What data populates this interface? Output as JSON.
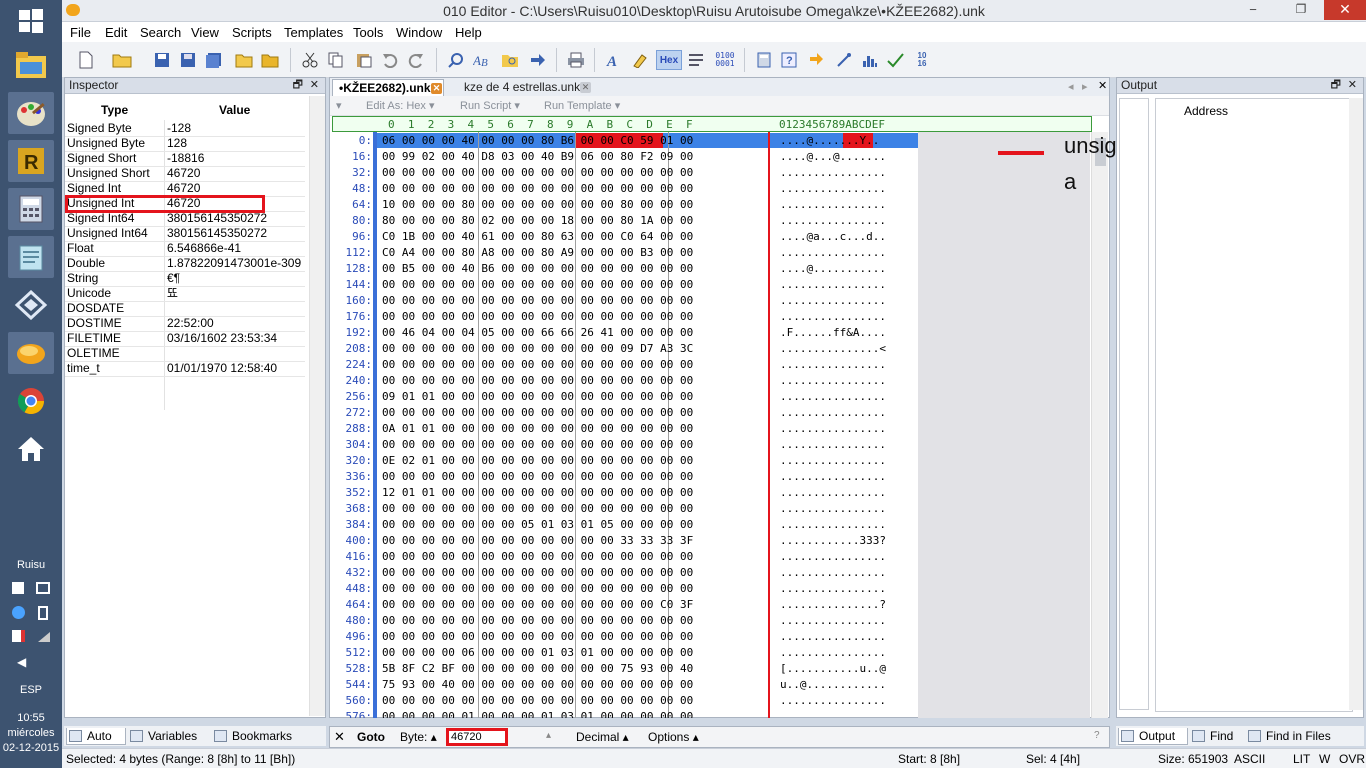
{
  "window": {
    "title": "010 Editor - C:\\Users\\Ruisu010\\Desktop\\Ruisu Arutoisube Omega\\kze\\•KŽEE2682).unk"
  },
  "menu": [
    "File",
    "Edit",
    "Search",
    "View",
    "Scripts",
    "Templates",
    "Tools",
    "Window",
    "Help"
  ],
  "taskbar": {
    "user": "Ruisu",
    "lang": "ESP",
    "time": "10:55",
    "day": "miércoles",
    "date": "02-12-2015"
  },
  "inspector": {
    "title": "Inspector",
    "col_type": "Type",
    "col_value": "Value",
    "rows": [
      {
        "type": "Signed Byte",
        "value": "-128"
      },
      {
        "type": "Unsigned Byte",
        "value": "128"
      },
      {
        "type": "Signed Short",
        "value": "-18816"
      },
      {
        "type": "Unsigned Short",
        "value": "46720"
      },
      {
        "type": "Signed Int",
        "value": "46720"
      },
      {
        "type": "Unsigned Int",
        "value": "46720"
      },
      {
        "type": "Signed Int64",
        "value": "380156145350272"
      },
      {
        "type": "Unsigned Int64",
        "value": "380156145350272"
      },
      {
        "type": "Float",
        "value": "6.546866e-41"
      },
      {
        "type": "Double",
        "value": "1.87822091473001e-309"
      },
      {
        "type": "String",
        "value": "€¶"
      },
      {
        "type": "Unicode",
        "value": "뚀"
      },
      {
        "type": "DOSDATE",
        "value": ""
      },
      {
        "type": "DOSTIME",
        "value": "22:52:00"
      },
      {
        "type": "FILETIME",
        "value": "03/16/1602 23:53:34"
      },
      {
        "type": "OLETIME",
        "value": ""
      },
      {
        "type": "time_t",
        "value": "01/01/1970 12:58:40"
      }
    ],
    "tabs": [
      "Auto",
      "Variables",
      "Bookmarks"
    ]
  },
  "editor": {
    "tabs": [
      "•KŽEE2682).unk",
      "kze de 4 estrellas.unk"
    ],
    "script_bar": [
      "Edit As: Hex",
      "Run Script",
      "Run Template"
    ],
    "hex_header": "0  1  2  3  4  5  6  7  8  9  A  B  C  D  E  F",
    "ascii_header": "0123456789ABCDEF",
    "rows": [
      {
        "off": "0:",
        "hex": "06 00 00 00 40 00 00 00 80 B6 00 00 C0 59 01 00",
        "asc": "....@.......Y.."
      },
      {
        "off": "16:",
        "hex": "00 99 02 00 40 D8 03 00 40 B9 06 00 80 F2 09 00",
        "asc": "....@...@......."
      },
      {
        "off": "32:",
        "hex": "00 00 00 00 00 00 00 00 00 00 00 00 00 00 00 00",
        "asc": "................"
      },
      {
        "off": "48:",
        "hex": "00 00 00 00 00 00 00 00 00 00 00 00 00 00 00 00",
        "asc": "................"
      },
      {
        "off": "64:",
        "hex": "10 00 00 00 80 00 00 00 00 00 00 00 80 00 00 00",
        "asc": "................"
      },
      {
        "off": "80:",
        "hex": "80 00 00 00 80 02 00 00 00 18 00 00 80 1A 00 00",
        "asc": "................"
      },
      {
        "off": "96:",
        "hex": "C0 1B 00 00 40 61 00 00 80 63 00 00 C0 64 00 00",
        "asc": "....@a...c...d.."
      },
      {
        "off": "112:",
        "hex": "C0 A4 00 00 80 A8 00 00 80 A9 00 00 00 B3 00 00",
        "asc": "................"
      },
      {
        "off": "128:",
        "hex": "00 B5 00 00 40 B6 00 00 00 00 00 00 00 00 00 00",
        "asc": "....@..........."
      },
      {
        "off": "144:",
        "hex": "00 00 00 00 00 00 00 00 00 00 00 00 00 00 00 00",
        "asc": "................"
      },
      {
        "off": "160:",
        "hex": "00 00 00 00 00 00 00 00 00 00 00 00 00 00 00 00",
        "asc": "................"
      },
      {
        "off": "176:",
        "hex": "00 00 00 00 00 00 00 00 00 00 00 00 00 00 00 00",
        "asc": "................"
      },
      {
        "off": "192:",
        "hex": "00 46 04 00 04 05 00 00 66 66 26 41 00 00 00 00",
        "asc": ".F......ff&A...."
      },
      {
        "off": "208:",
        "hex": "00 00 00 00 00 00 00 00 00 00 00 00 09 D7 A3 3C",
        "asc": "...............<"
      },
      {
        "off": "224:",
        "hex": "00 00 00 00 00 00 00 00 00 00 00 00 00 00 00 00",
        "asc": "................"
      },
      {
        "off": "240:",
        "hex": "00 00 00 00 00 00 00 00 00 00 00 00 00 00 00 00",
        "asc": "................"
      },
      {
        "off": "256:",
        "hex": "09 01 01 00 00 00 00 00 00 00 00 00 00 00 00 00",
        "asc": "................"
      },
      {
        "off": "272:",
        "hex": "00 00 00 00 00 00 00 00 00 00 00 00 00 00 00 00",
        "asc": "................"
      },
      {
        "off": "288:",
        "hex": "0A 01 01 00 00 00 00 00 00 00 00 00 00 00 00 00",
        "asc": "................"
      },
      {
        "off": "304:",
        "hex": "00 00 00 00 00 00 00 00 00 00 00 00 00 00 00 00",
        "asc": "................"
      },
      {
        "off": "320:",
        "hex": "0E 02 01 00 00 00 00 00 00 00 00 00 00 00 00 00",
        "asc": "................"
      },
      {
        "off": "336:",
        "hex": "00 00 00 00 00 00 00 00 00 00 00 00 00 00 00 00",
        "asc": "................"
      },
      {
        "off": "352:",
        "hex": "12 01 01 00 00 00 00 00 00 00 00 00 00 00 00 00",
        "asc": "................"
      },
      {
        "off": "368:",
        "hex": "00 00 00 00 00 00 00 00 00 00 00 00 00 00 00 00",
        "asc": "................"
      },
      {
        "off": "384:",
        "hex": "00 00 00 00 00 00 00 05 01 03 01 05 00 00 00 00",
        "asc": "................"
      },
      {
        "off": "400:",
        "hex": "00 00 00 00 00 00 00 00 00 00 00 00 33 33 33 3F",
        "asc": "............333?"
      },
      {
        "off": "416:",
        "hex": "00 00 00 00 00 00 00 00 00 00 00 00 00 00 00 00",
        "asc": "................"
      },
      {
        "off": "432:",
        "hex": "00 00 00 00 00 00 00 00 00 00 00 00 00 00 00 00",
        "asc": "................"
      },
      {
        "off": "448:",
        "hex": "00 00 00 00 00 00 00 00 00 00 00 00 00 00 00 00",
        "asc": "................"
      },
      {
        "off": "464:",
        "hex": "00 00 00 00 00 00 00 00 00 00 00 00 00 00 C0 3F",
        "asc": "...............?"
      },
      {
        "off": "480:",
        "hex": "00 00 00 00 00 00 00 00 00 00 00 00 00 00 00 00",
        "asc": "................"
      },
      {
        "off": "496:",
        "hex": "00 00 00 00 00 00 00 00 00 00 00 00 00 00 00 00",
        "asc": "................"
      },
      {
        "off": "512:",
        "hex": "00 00 00 00 06 00 00 00 01 03 01 00 00 00 00 00",
        "asc": "................"
      },
      {
        "off": "528:",
        "hex": "5B 8F C2 BF 00 00 00 00 00 00 00 00 75 93 00 40",
        "asc": "[...........u..@"
      },
      {
        "off": "544:",
        "hex": "75 93 00 40 00 00 00 00 00 00 00 00 00 00 00 00",
        "asc": "u..@............"
      },
      {
        "off": "560:",
        "hex": "00 00 00 00 00 00 00 00 00 00 00 00 00 00 00 00",
        "asc": "................"
      },
      {
        "off": "576:",
        "hex": "00 00 00 00 01 00 00 00 01 03 01 00 00 00 00 00",
        "asc": "................"
      }
    ]
  },
  "annotation": {
    "text": "unsigned int en funcion ir a"
  },
  "output": {
    "title": "Output",
    "col": "Address",
    "tabs": [
      "Output",
      "Find",
      "Find in Files"
    ]
  },
  "goto": {
    "label": "Goto",
    "byte_label": "Byte:",
    "value": "46720",
    "mode": "Decimal",
    "options": "Options"
  },
  "status": {
    "selected": "Selected: 4 bytes (Range: 8 [8h] to 11 [Bh])",
    "start": "Start: 8 [8h]",
    "sel": "Sel: 4 [4h]",
    "size": "Size: 651903",
    "enc": "ASCII",
    "lit": "LIT",
    "w": "W",
    "ovr": "OVR"
  },
  "colors": {
    "selection": "#3c82e6",
    "highlight": "#e4141c"
  }
}
